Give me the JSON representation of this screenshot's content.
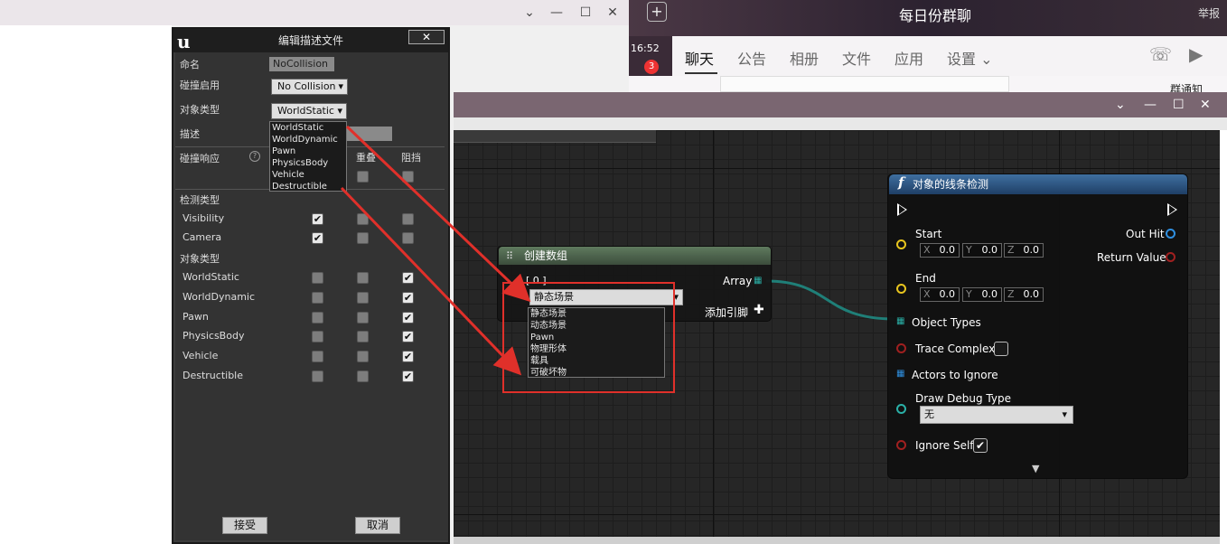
{
  "topbar": {
    "min": "—",
    "max": "☐",
    "close": "✕",
    "chevron": "⌄"
  },
  "chat": {
    "title": "每日份群聊",
    "report": "举报",
    "time": "16:52",
    "badge": "3",
    "tabs": [
      "聊天",
      "公告",
      "相册",
      "文件",
      "应用",
      "设置 ⌄"
    ],
    "notice": "群通知",
    "plus": "+"
  },
  "editor_window": {
    "min": "—",
    "max": "☐",
    "close": "✕",
    "chevron": "⌄"
  },
  "dialog": {
    "title": "编辑描述文件",
    "close": "✕",
    "name_label": "命名",
    "name_value": "NoCollision",
    "collision_enabled_label": "碰撞启用",
    "collision_enabled_value": "No Collision",
    "object_type_label": "对象类型",
    "object_type_value": "WorldStatic",
    "description_label": "描述",
    "collision_response_label": "碰撞响应",
    "col_overlap": "重叠",
    "col_block": "阻挡",
    "trace_types_label": "检测类型",
    "object_types_label": "对象类型",
    "trace_rows": [
      {
        "label": "Visibility",
        "ignore": true,
        "overlap": false,
        "block": false
      },
      {
        "label": "Camera",
        "ignore": true,
        "overlap": false,
        "block": false
      }
    ],
    "object_rows": [
      {
        "label": "WorldStatic",
        "ignore": false,
        "overlap": false,
        "block": true
      },
      {
        "label": "WorldDynamic",
        "ignore": false,
        "overlap": false,
        "block": true
      },
      {
        "label": "Pawn",
        "ignore": false,
        "overlap": false,
        "block": true
      },
      {
        "label": "PhysicsBody",
        "ignore": false,
        "overlap": false,
        "block": true
      },
      {
        "label": "Vehicle",
        "ignore": false,
        "overlap": false,
        "block": true
      },
      {
        "label": "Destructible",
        "ignore": false,
        "overlap": false,
        "block": true
      }
    ],
    "object_type_options": [
      "WorldStatic",
      "WorldDynamic",
      "Pawn",
      "PhysicsBody",
      "Vehicle",
      "Destructible"
    ],
    "accept": "接受",
    "cancel": "取消"
  },
  "make_array_node": {
    "title": "创建数组",
    "index": "[ 0 ]",
    "output": "Array",
    "selected": "静态场景",
    "add_pin": "添加引脚",
    "options": [
      "静态场景",
      "动态场景",
      "Pawn",
      "物理形体",
      "载具",
      "可破坏物"
    ]
  },
  "trace_node": {
    "title": "对象的线条检测",
    "start": "Start",
    "end": "End",
    "out_hit": "Out Hit",
    "return_value": "Return Value",
    "start_xyz": [
      "0.0",
      "0.0",
      "0.0"
    ],
    "end_xyz": [
      "0.0",
      "0.0",
      "0.0"
    ],
    "object_types": "Object Types",
    "trace_complex": "Trace Complex",
    "actors_to_ignore": "Actors to Ignore",
    "draw_debug_type": "Draw Debug Type",
    "draw_debug_value": "无",
    "ignore_self": "Ignore Self",
    "axis": [
      "X",
      "Y",
      "Z"
    ]
  },
  "colors": {
    "annotation_red": "#e0302a",
    "array_wire": "#1f7f78",
    "vector_pin": "#e8c51e",
    "struct_pin_blue": "#2f8fe0",
    "bool_pin": "#a02020"
  }
}
